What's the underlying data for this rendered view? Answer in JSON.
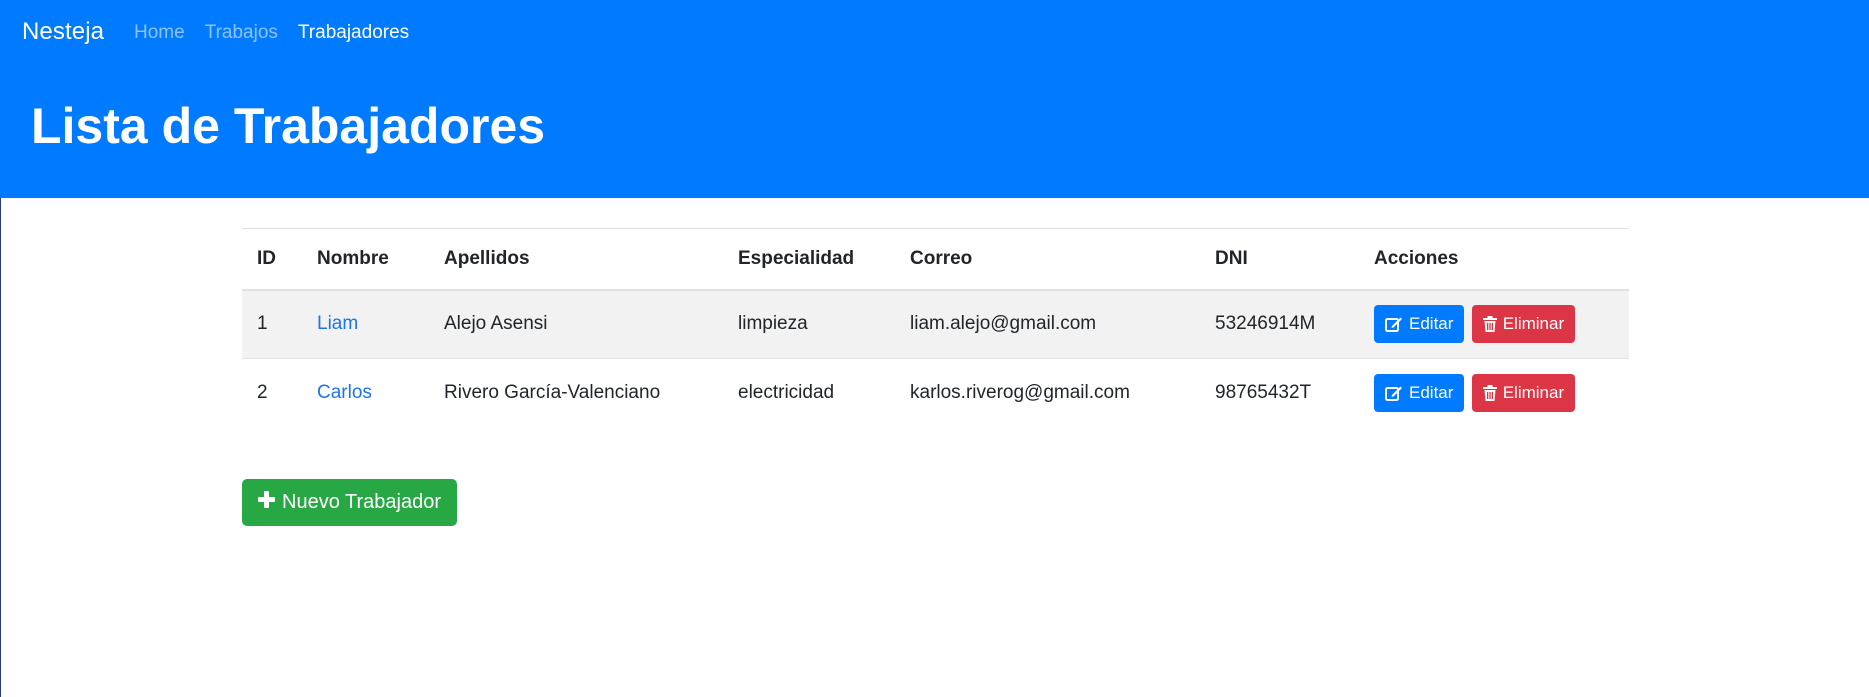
{
  "navbar": {
    "brand": "Nesteja",
    "links": [
      {
        "label": "Home",
        "active": false
      },
      {
        "label": "Trabajos",
        "active": false
      },
      {
        "label": "Trabajadores",
        "active": true
      }
    ]
  },
  "hero": {
    "title": "Lista de Trabajadores"
  },
  "table": {
    "headers": [
      "ID",
      "Nombre",
      "Apellidos",
      "Especialidad",
      "Correo",
      "DNI",
      "Acciones"
    ],
    "rows": [
      {
        "id": "1",
        "nombre": "Liam",
        "apellidos": "Alejo Asensi",
        "especialidad": "limpieza",
        "correo": "liam.alejo@gmail.com",
        "dni": "53246914M"
      },
      {
        "id": "2",
        "nombre": "Carlos",
        "apellidos": "Rivero García-Valenciano",
        "especialidad": "electricidad",
        "correo": "karlos.riverog@gmail.com",
        "dni": "98765432T"
      }
    ],
    "actions": {
      "edit_label": "Editar",
      "edit_icon": "edit-icon",
      "delete_label": "Eliminar",
      "delete_icon": "trash-icon"
    }
  },
  "new_button": {
    "label": "Nuevo Trabajador",
    "icon": "plus-icon"
  },
  "colors": {
    "primary": "#007bff",
    "danger": "#dc3545",
    "success": "#28a745",
    "link": "#1d73e8"
  }
}
